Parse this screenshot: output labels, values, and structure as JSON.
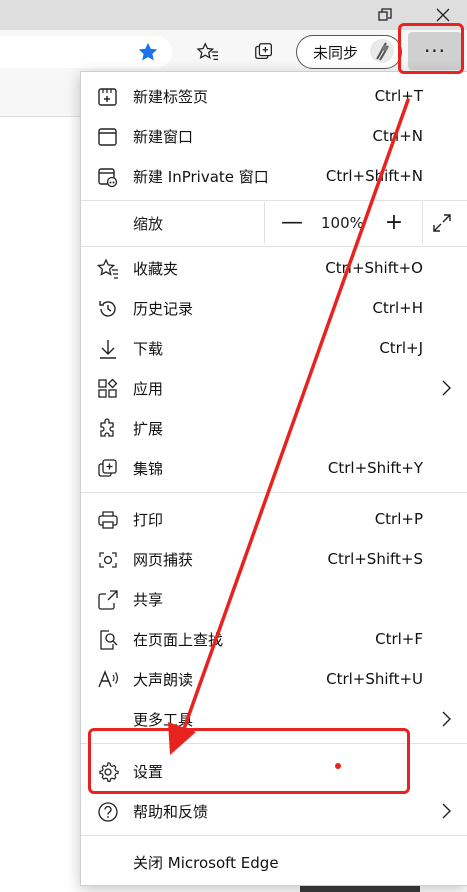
{
  "toolbar": {
    "sync_label": "未同步",
    "more_label": "···"
  },
  "menu": {
    "new_tab": {
      "label": "新建标签页",
      "shortcut": "Ctrl+T"
    },
    "new_window": {
      "label": "新建窗口",
      "shortcut": "Ctrl+N"
    },
    "new_inprivate": {
      "label": "新建 InPrivate 窗口",
      "shortcut": "Ctrl+Shift+N"
    },
    "zoom": {
      "label": "缩放",
      "value": "100%",
      "minus": "—",
      "plus": "+"
    },
    "favorites": {
      "label": "收藏夹",
      "shortcut": "Ctrl+Shift+O"
    },
    "history": {
      "label": "历史记录",
      "shortcut": "Ctrl+H"
    },
    "downloads": {
      "label": "下载",
      "shortcut": "Ctrl+J"
    },
    "apps": {
      "label": "应用"
    },
    "extensions": {
      "label": "扩展"
    },
    "collections": {
      "label": "集锦",
      "shortcut": "Ctrl+Shift+Y"
    },
    "print": {
      "label": "打印",
      "shortcut": "Ctrl+P"
    },
    "web_capture": {
      "label": "网页捕获",
      "shortcut": "Ctrl+Shift+S"
    },
    "share": {
      "label": "共享"
    },
    "find": {
      "label": "在页面上查找",
      "shortcut": "Ctrl+F"
    },
    "read_aloud": {
      "label": "大声朗读",
      "shortcut": "Ctrl+Shift+U"
    },
    "more_tools": {
      "label": "更多工具"
    },
    "settings": {
      "label": "设置"
    },
    "help": {
      "label": "帮助和反馈"
    },
    "close": {
      "label": "关闭 Microsoft Edge"
    }
  },
  "annotation": {
    "color": "#e8231f"
  }
}
